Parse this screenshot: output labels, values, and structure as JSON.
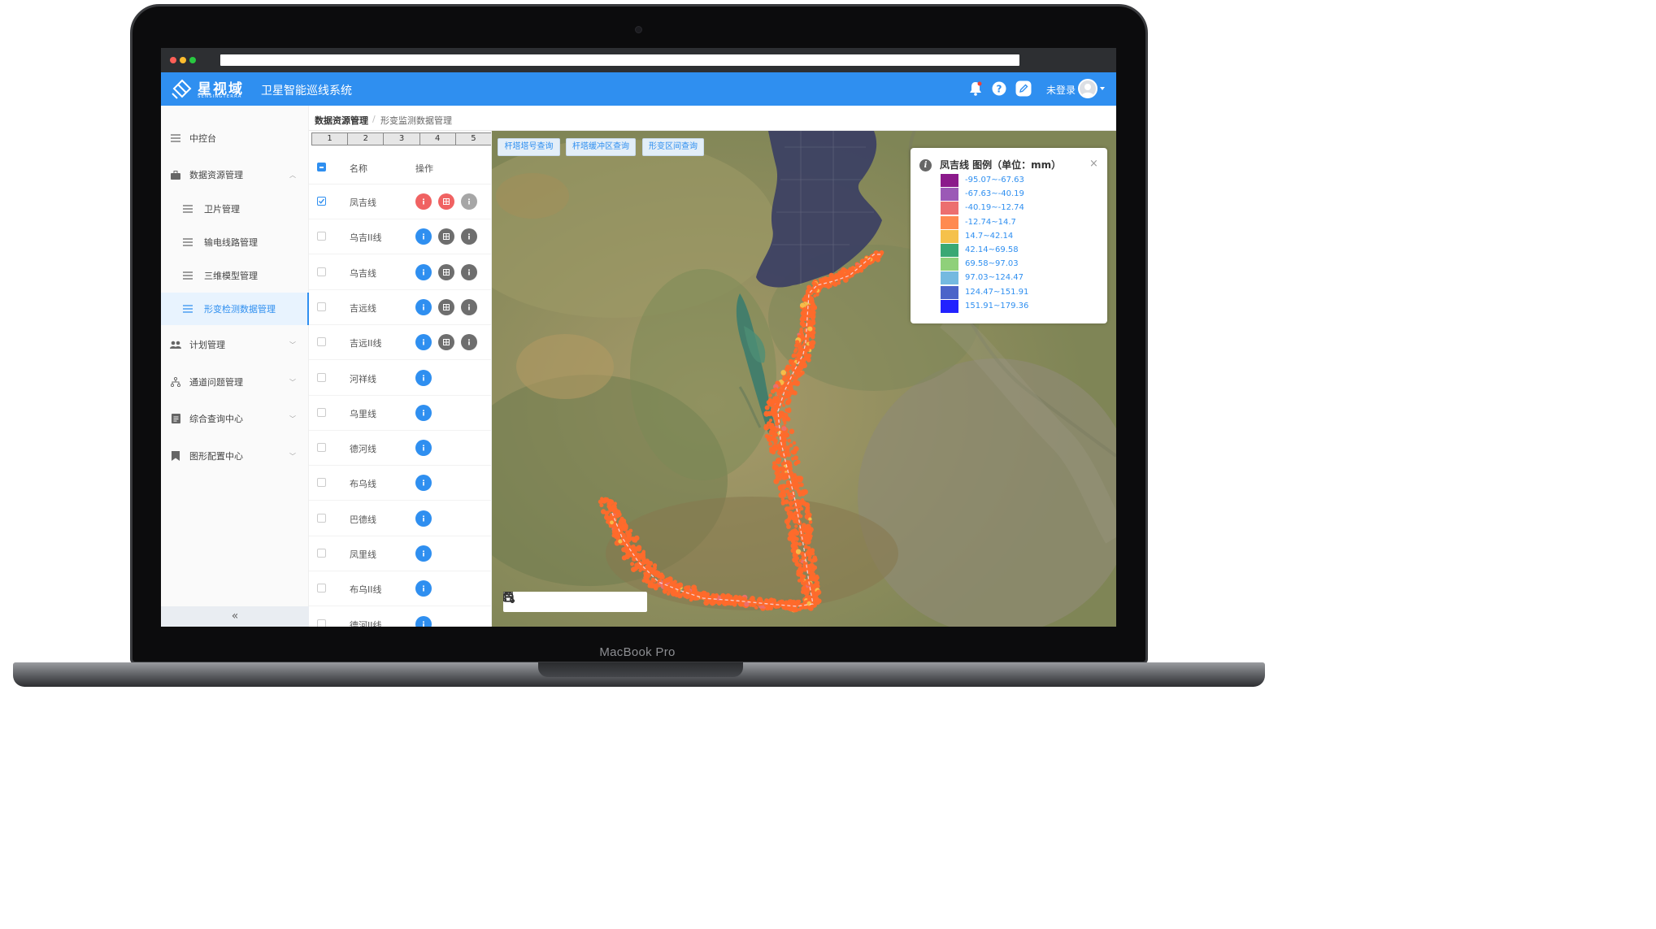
{
  "device": {
    "label": "MacBook Pro"
  },
  "header": {
    "logo_cn": "星视域",
    "logo_en": "SENSINGTERRA",
    "app_title": "卫星智能巡线系统",
    "user_label": "未登录",
    "icons": [
      "bell-icon",
      "help-icon",
      "edit-icon"
    ],
    "accent_color": "#2f8ff0"
  },
  "sidebar": {
    "items": [
      {
        "label": "中控台",
        "icon": "menu-icon"
      },
      {
        "label": "数据资源管理",
        "icon": "briefcase-icon",
        "expanded": true
      },
      {
        "label": "卫片管理",
        "icon": "menu-icon"
      },
      {
        "label": "输电线路管理",
        "icon": "menu-icon"
      },
      {
        "label": "三维模型管理",
        "icon": "menu-icon"
      },
      {
        "label": "形变检测数据管理",
        "icon": "menu-icon",
        "active": true
      },
      {
        "label": "计划管理",
        "icon": "users-icon"
      },
      {
        "label": "通道问题管理",
        "icon": "org-chart-icon"
      },
      {
        "label": "综合查询中心",
        "icon": "document-icon"
      },
      {
        "label": "图形配置中心",
        "icon": "bookmark-icon"
      }
    ],
    "collapse_label": "«"
  },
  "breadcrumb": {
    "root": "数据资源管理",
    "separator": "/",
    "current": "形变监测数据管理"
  },
  "list": {
    "pages": [
      "1",
      "2",
      "3",
      "4",
      "5"
    ],
    "col_name": "名称",
    "col_action": "操作",
    "rows": [
      {
        "name": "凤吉线",
        "checked": true
      },
      {
        "name": "乌吉II线",
        "checked": false
      },
      {
        "name": "乌吉线",
        "checked": false
      },
      {
        "name": "吉远线",
        "checked": false
      },
      {
        "name": "吉远II线",
        "checked": false
      },
      {
        "name": "河祥线",
        "checked": false
      },
      {
        "name": "乌里线",
        "checked": false
      },
      {
        "name": "德河线",
        "checked": false
      },
      {
        "name": "布乌线",
        "checked": false
      },
      {
        "name": "巴德线",
        "checked": false
      },
      {
        "name": "凤里线",
        "checked": false
      },
      {
        "name": "布乌II线",
        "checked": false
      },
      {
        "name": "德河II线",
        "checked": false
      }
    ]
  },
  "map": {
    "buttons": [
      "杆塔塔号查询",
      "杆塔缓冲区查询",
      "形变区间查询"
    ],
    "tools": [
      "ruler-icon",
      "area-measure-icon",
      "crop-icon",
      "fullscreen-icon",
      "print-icon",
      "layers-tree-icon"
    ]
  },
  "legend": {
    "title": "凤吉线 图例（单位：mm）",
    "close": "×",
    "items": [
      {
        "label": "-95.07~-67.63",
        "color": "#8b1a8b"
      },
      {
        "label": "-67.63~-40.19",
        "color": "#9b59b6"
      },
      {
        "label": "-40.19~-12.74",
        "color": "#ec6f6f"
      },
      {
        "label": "-12.74~14.7",
        "color": "#ff8a50"
      },
      {
        "label": "14.7~42.14",
        "color": "#f5c14b"
      },
      {
        "label": "42.14~69.58",
        "color": "#3aa874"
      },
      {
        "label": "69.58~97.03",
        "color": "#8fd07a"
      },
      {
        "label": "97.03~124.47",
        "color": "#74b9e0"
      },
      {
        "label": "124.47~151.91",
        "color": "#4b63c9"
      },
      {
        "label": "151.91~179.36",
        "color": "#2222ff"
      }
    ]
  }
}
